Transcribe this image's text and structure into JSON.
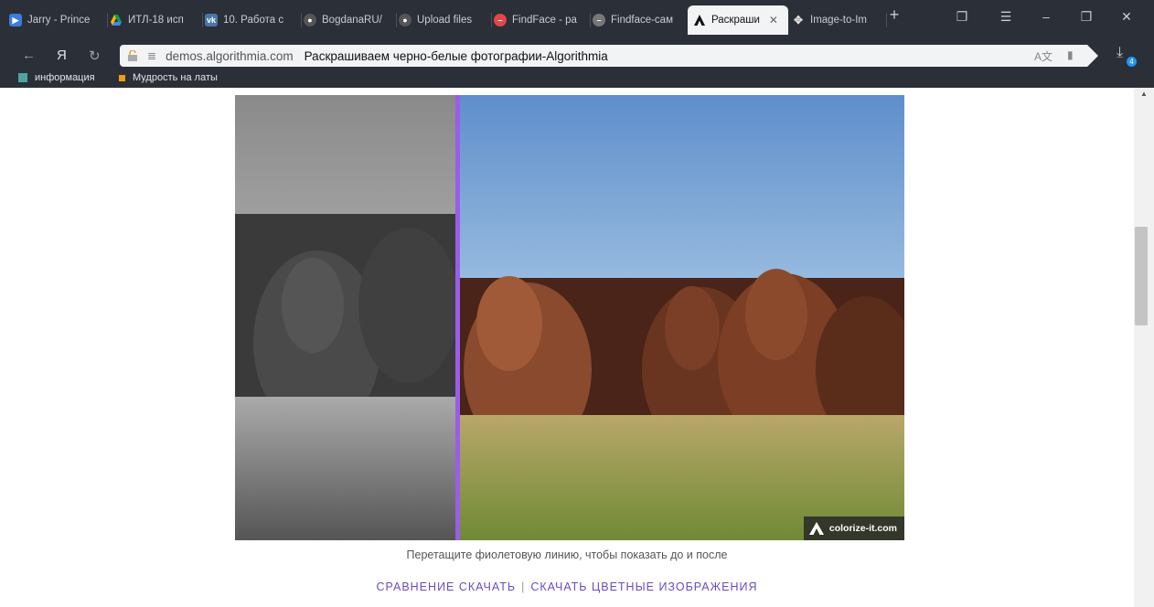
{
  "browser": {
    "tabs": [
      {
        "title": "Jarry - Prince",
        "icon": "youtube-icon",
        "color": "#3b7ddd"
      },
      {
        "title": "ИТЛ-18 исп",
        "icon": "google-drive-icon",
        "color": "#f4b400"
      },
      {
        "title": "10. Работа с",
        "icon": "vk-icon",
        "color": "#4a76a8"
      },
      {
        "title": "BogdanaRU/",
        "icon": "github-icon",
        "color": "#444"
      },
      {
        "title": "Upload files",
        "icon": "github-icon",
        "color": "#444"
      },
      {
        "title": "FindFace - ра",
        "icon": "findface-icon",
        "color": "#e04848"
      },
      {
        "title": "Findface-сам",
        "icon": "findface-icon",
        "color": "#888"
      },
      {
        "title": "Раскраши",
        "icon": "algorithmia-icon",
        "color": "#111"
      },
      {
        "title": "Image-to-Im",
        "icon": "puzzle-icon",
        "color": "#ccc"
      }
    ],
    "new_tab": "+",
    "address": {
      "domain": "demos.algorithmia.com",
      "page_title": "Раскрашиваем черно-белые фотографии-Algorithmia"
    },
    "downloads_count": "4",
    "bookmarks": [
      {
        "label": "информация",
        "color": "#4fa3a0"
      },
      {
        "label": "Мудрость на латы",
        "color": "#f39c12"
      }
    ]
  },
  "page": {
    "watermark": "colorize-it.com",
    "caption": "Перетащите фиолетовую линию, чтобы показать до и после",
    "link_compare": "СРАВНЕНИЕ СКАЧАТЬ",
    "link_separator": "|",
    "link_download_color": "СКАЧАТЬ ЦВЕТНЫЕ ИЗОБРАЖЕНИЯ",
    "divider_color": "#9a5ee6"
  }
}
